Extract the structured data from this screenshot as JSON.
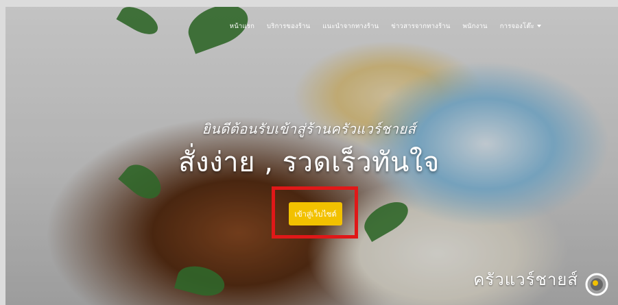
{
  "nav": {
    "items": [
      {
        "label": "หน้าแรก"
      },
      {
        "label": "บริการของร้าน"
      },
      {
        "label": "แนะนำจากทางร้าน"
      },
      {
        "label": "ข่าวสารจากทางร้าน"
      },
      {
        "label": "พนักงาน"
      },
      {
        "label": "การจองโต๊ะ"
      }
    ]
  },
  "hero": {
    "welcome": "ยินดีต้อนรับเข้าสู่ร้านครัวแวร์ชายส์",
    "headline": "สั่งง่าย , รวดเร็วทันใจ",
    "cta_label": "เข้าสู่เว็บไซต์"
  },
  "brand": {
    "name": "ครัวแวร์ชายส์"
  },
  "colors": {
    "cta": "#f2c100",
    "highlight": "#e01818"
  }
}
